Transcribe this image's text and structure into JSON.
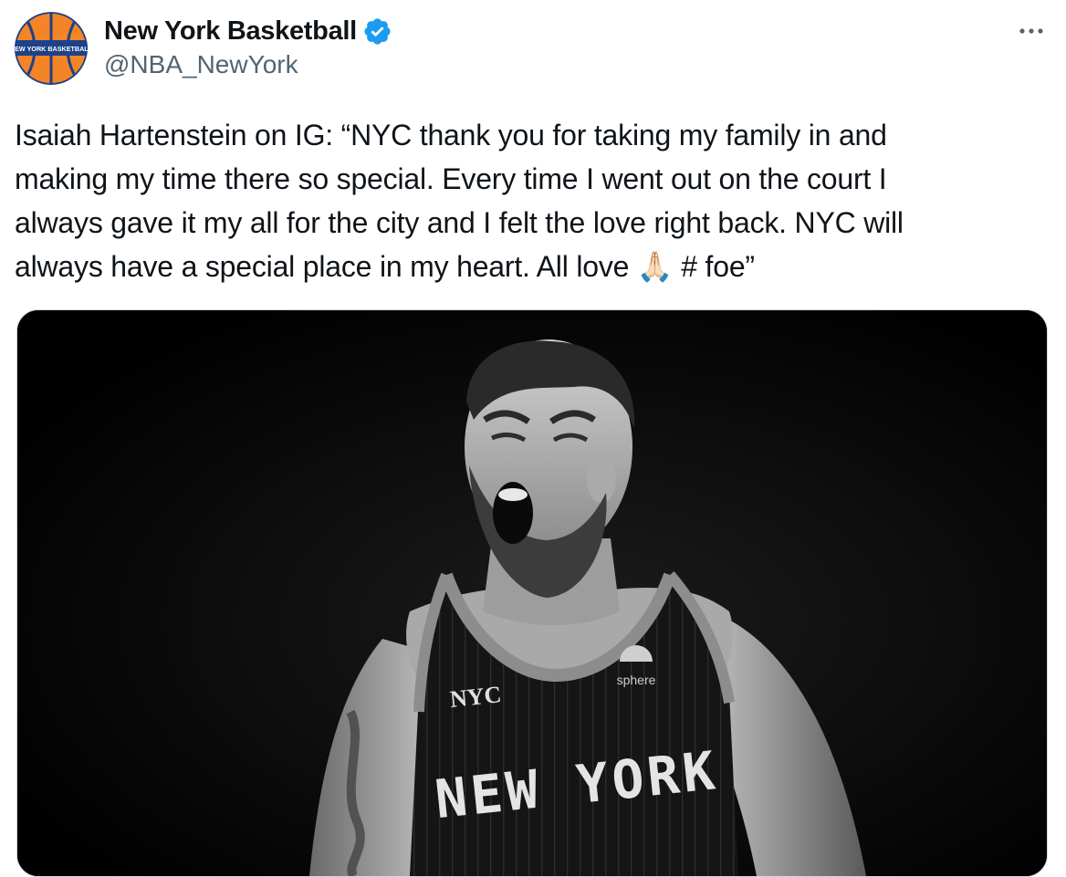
{
  "colors": {
    "verified_blue": "#1d9bf0",
    "text_primary": "#0f1419",
    "text_secondary": "#536471",
    "media_border": "#cfd9de",
    "knicks_orange": "#f58426",
    "knicks_blue": "#1d428a"
  },
  "tweet": {
    "author": {
      "display_name": "New York Basketball",
      "handle": "@NBA_NewYork",
      "avatar_text": "NEW YORK BASKETBALL",
      "verified_icon": "verified-badge-icon"
    },
    "more_icon": "more-options-icon",
    "text": "Isaiah Hartenstein on IG: “NYC thank you for taking my family in and\nmaking my time there so special. Every time I went out on the court I\nalways gave it my all for the city and I felt the love right back. NYC will\nalways have a special place in my heart. All love 🙏🏻 # foe”",
    "media": {
      "jersey_logo": "NYC",
      "jersey_sponsor": "sphere",
      "jersey_text": "NEW YORK"
    }
  }
}
